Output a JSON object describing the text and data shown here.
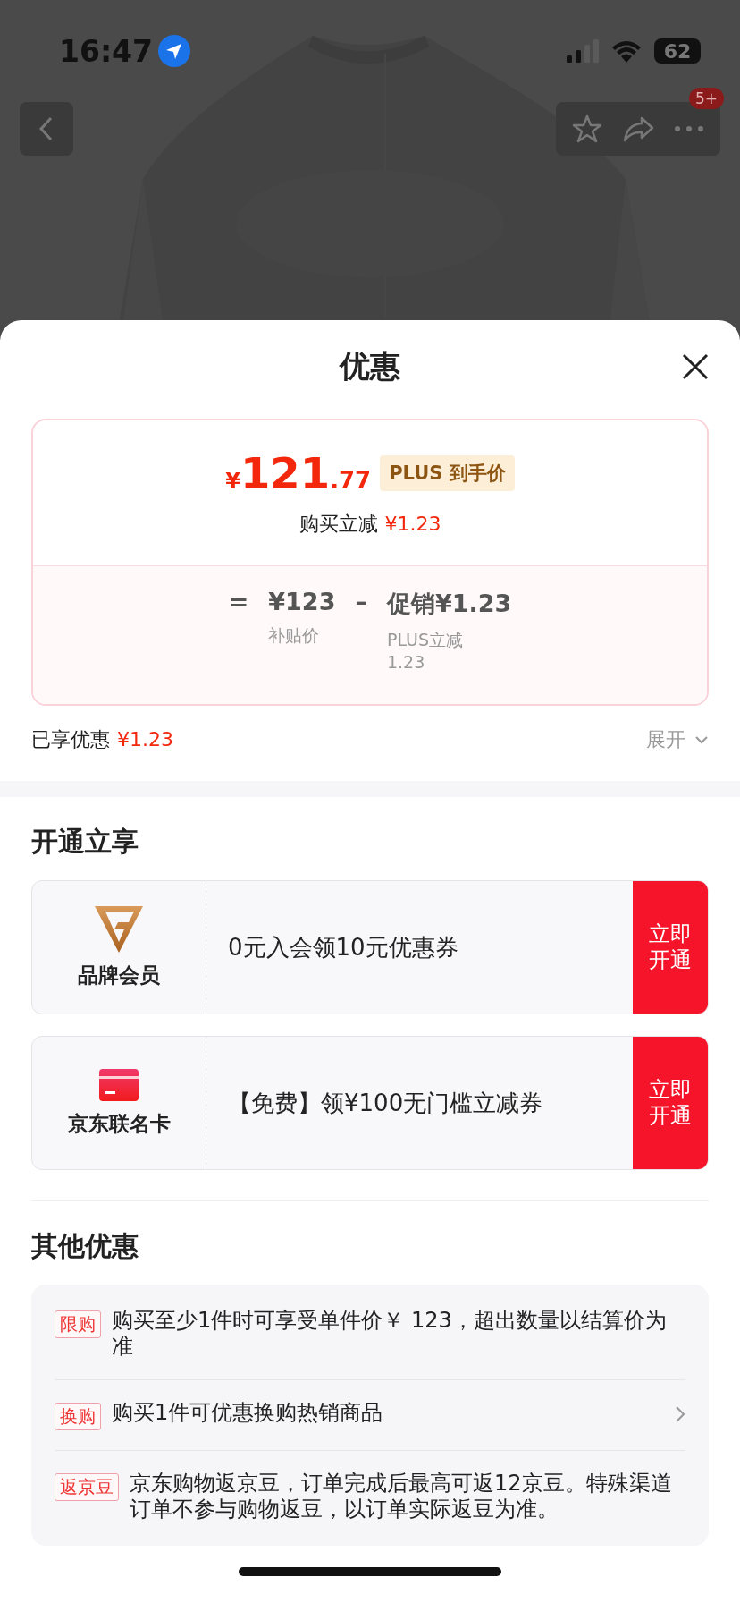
{
  "status_bar": {
    "time": "16:47",
    "battery": "62"
  },
  "nav": {
    "badge": "5+"
  },
  "sheet": {
    "title": "优惠"
  },
  "price_card": {
    "currency": "¥",
    "price_integer": "121",
    "price_decimal": ".77",
    "price_tag": "PLUS 到手价",
    "discount_label": "购买立减",
    "discount_amount": "¥1.23",
    "formula": [
      {
        "kind": "operator",
        "value": "="
      },
      {
        "kind": "term",
        "value": "¥123",
        "caption": [
          "补贴价"
        ]
      },
      {
        "kind": "operator",
        "value": "–"
      },
      {
        "kind": "term",
        "value": "促销¥1.23",
        "caption": [
          "PLUS立减",
          "1.23"
        ]
      }
    ]
  },
  "savings": {
    "label": "已享优惠",
    "amount": "¥1.23",
    "expand_label": "展开",
    "expanded": false
  },
  "membership": {
    "title": "开通立享",
    "cards": [
      {
        "kind": "brand",
        "name": "品牌会员",
        "offer": "0元入会领10元优惠券",
        "action": "立即开通"
      },
      {
        "kind": "card",
        "name": "京东联名卡",
        "offer": "【免费】领¥100无门槛立减券",
        "action": "立即开通"
      }
    ]
  },
  "other": {
    "title": "其他优惠",
    "items": [
      {
        "tag": "限购",
        "text": "购买至少1件时可享受单件价￥ 123，超出数量以结算价为准",
        "has_arrow": false
      },
      {
        "tag": "换购",
        "text": "购买1件可优惠换购热销商品",
        "has_arrow": true
      },
      {
        "tag": "返京豆",
        "text": "京东购物返京豆，订单完成后最高可返12京豆。特殊渠道订单不参与购物返豆，以订单实际返豆为准。",
        "has_arrow": false
      }
    ]
  }
}
